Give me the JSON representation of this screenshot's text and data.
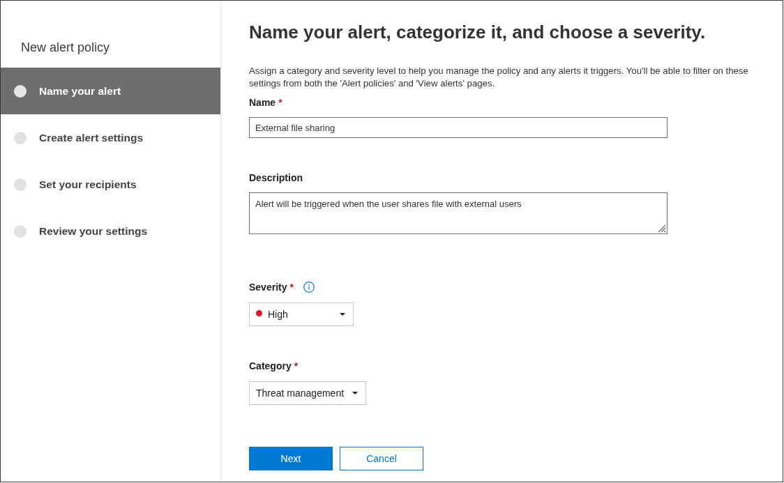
{
  "sidebar": {
    "title": "New alert policy",
    "steps": [
      {
        "label": "Name your alert",
        "selected": true
      },
      {
        "label": "Create alert settings",
        "selected": false
      },
      {
        "label": "Set your recipients",
        "selected": false
      },
      {
        "label": "Review your settings",
        "selected": false
      }
    ]
  },
  "main": {
    "heading": "Name your alert, categorize it, and choose a severity.",
    "intro": "Assign a category and severity level to help you manage the policy and any alerts it triggers. You'll be able to filter on these settings from both the 'Alert policies' and 'View alerts' pages.",
    "name_field": {
      "label": "Name",
      "required_mark": "*",
      "value": "External file sharing"
    },
    "description_field": {
      "label": "Description",
      "value": "Alert will be triggered when the user shares file with external users",
      "resizable": true
    },
    "severity": {
      "label": "Severity",
      "required_mark": "*",
      "info": true,
      "value": "High",
      "color": "#e81123"
    },
    "category": {
      "label": "Category",
      "required_mark": "*",
      "value": "Threat management"
    }
  },
  "buttons": [
    {
      "label": "Next",
      "kind": "primary"
    },
    {
      "label": "Cancel",
      "kind": "secondary"
    }
  ]
}
